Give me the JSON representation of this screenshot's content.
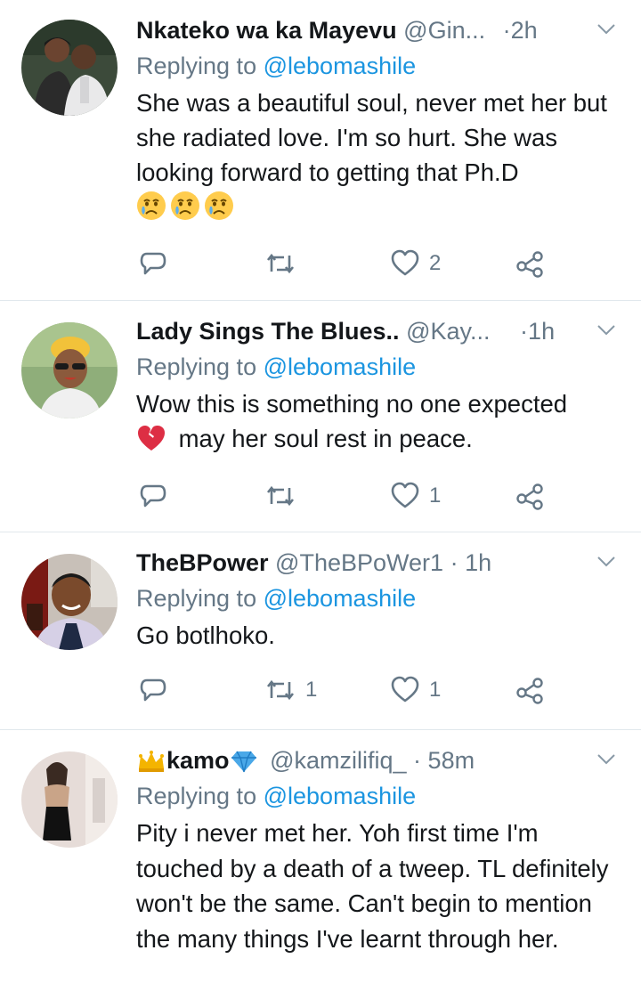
{
  "tweets": [
    {
      "name": "Nkateko wa ka Mayevu",
      "handle": "@Gin...",
      "sep": "·",
      "time": "2h",
      "replying_prefix": "Replying to",
      "replying_to": "@lebomashile",
      "text": "She was a beautiful soul, never met her but she radiated love. I'm so hurt. She was looking forward to getting that Ph.D",
      "emoji": [
        "crying-face",
        "crying-face",
        "crying-face"
      ],
      "retweets": "",
      "likes": "2"
    },
    {
      "name": "Lady Sings The Blues..",
      "handle": "@Kay...",
      "sep": "·",
      "time": "1h",
      "replying_prefix": "Replying to",
      "replying_to": "@lebomashile",
      "text_line1": "Wow this is something no one expected",
      "emoji": [
        "broken-heart"
      ],
      "text_line2": "may her soul rest in peace.",
      "retweets": "",
      "likes": "1"
    },
    {
      "name": "TheBPower",
      "handle": "@TheBPoWer1",
      "sep": "·",
      "time": "1h",
      "replying_prefix": "Replying to",
      "replying_to": "@lebomashile",
      "text": "Go botlhoko.",
      "retweets": "1",
      "likes": "1"
    },
    {
      "name": "kamo",
      "name_emoji": [
        "crown",
        "gem"
      ],
      "handle": "@kamzilifiq_",
      "sep": "·",
      "time": "58m",
      "replying_prefix": "Replying to",
      "replying_to": "@lebomashile",
      "text": "Pity i never met her. Yoh first time I'm touched by a death of a tweep. TL definitely won't be the same. Can't begin to mention the many things I've learnt through her."
    }
  ],
  "colors": {
    "text": "#14171a",
    "secondary": "#657786",
    "link": "#1b95e0",
    "divider": "#e1e8ed"
  }
}
